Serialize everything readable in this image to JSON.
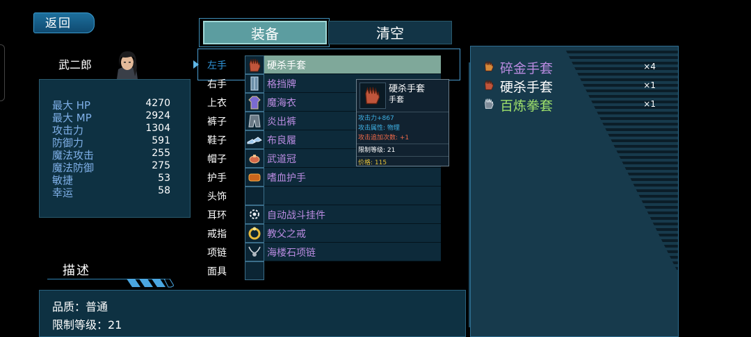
{
  "back_button": "返回",
  "character": {
    "name": "武二郎",
    "stats": [
      {
        "label": "最大 HP",
        "value": "4270"
      },
      {
        "label": "最大 MP",
        "value": "2924"
      },
      {
        "label": "攻击力",
        "value": "1304"
      },
      {
        "label": "防御力",
        "value": "591"
      },
      {
        "label": "魔法攻击",
        "value": "255"
      },
      {
        "label": "魔法防御",
        "value": "275"
      },
      {
        "label": "敏捷",
        "value": "53"
      },
      {
        "label": "幸运",
        "value": "58"
      }
    ]
  },
  "description": {
    "title": "描述",
    "quality": "品质：普通",
    "level_req": "限制等级：21"
  },
  "tabs": {
    "equip": "装备",
    "clear": "清空"
  },
  "equipment": [
    {
      "slot": "左手",
      "item": "硬杀手套",
      "icon": "glove-icon"
    },
    {
      "slot": "右手",
      "item": "格挡牌",
      "icon": "shield-icon"
    },
    {
      "slot": "上衣",
      "item": "魔海衣",
      "icon": "robe-icon"
    },
    {
      "slot": "裤子",
      "item": "炎出裤",
      "icon": "pants-icon"
    },
    {
      "slot": "鞋子",
      "item": "布良履",
      "icon": "shoes-icon"
    },
    {
      "slot": "帽子",
      "item": "武道冠",
      "icon": "crown-icon"
    },
    {
      "slot": "护手",
      "item": "嗜血护手",
      "icon": "bracer-icon"
    },
    {
      "slot": "头饰",
      "item": "",
      "icon": ""
    },
    {
      "slot": "耳环",
      "item": "自动战斗挂件",
      "icon": "gear-icon"
    },
    {
      "slot": "戒指",
      "item": "教父之戒",
      "icon": "ring-icon"
    },
    {
      "slot": "项链",
      "item": "海楼石项链",
      "icon": "necklace-icon"
    },
    {
      "slot": "面具",
      "item": "",
      "icon": ""
    }
  ],
  "tooltip": {
    "name": "硬杀手套",
    "type": "手套",
    "attack": "攻击力+867",
    "attribute": "攻击属性: 物理",
    "extra_hits": "攻击追加次数: +1",
    "level_req": "限制等级: 21",
    "price": "价格: 115"
  },
  "inventory": [
    {
      "name": "碎金手套",
      "qty": "×4",
      "color": "#b98be0",
      "icon": "glove-icon"
    },
    {
      "name": "硬杀手套",
      "qty": "×1",
      "color": "#ffffff",
      "icon": "glove-icon"
    },
    {
      "name": "百炼拳套",
      "qty": "×1",
      "color": "#9ee06b",
      "icon": "gauntlet-icon"
    }
  ]
}
